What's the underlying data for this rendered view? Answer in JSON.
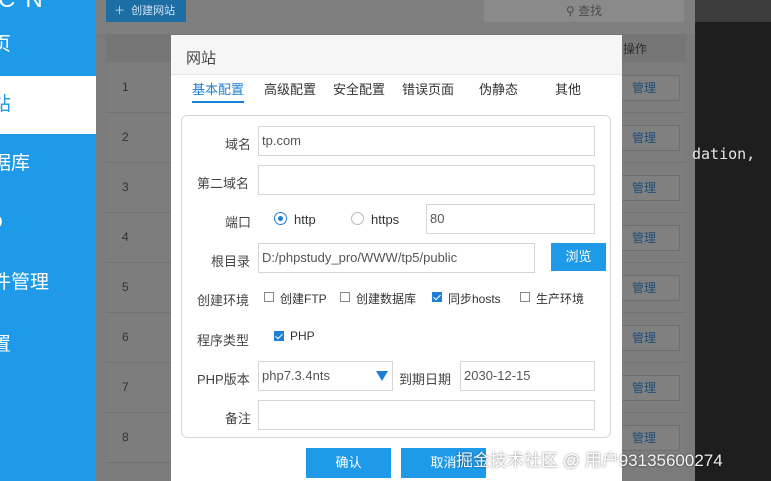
{
  "sidebar": {
    "logo": "CN",
    "items": [
      {
        "label": "页"
      },
      {
        "label": "站"
      },
      {
        "label": "据库"
      },
      {
        "label": "p"
      },
      {
        "label": "件管理"
      },
      {
        "label": "置"
      }
    ]
  },
  "toolbar": {
    "create_label": "创建网站",
    "search_label": "查找"
  },
  "table": {
    "action_header": "操作",
    "rows": [
      {
        "num": "1",
        "action": "管理"
      },
      {
        "num": "2",
        "action": "管理"
      },
      {
        "num": "3",
        "action": "管理"
      },
      {
        "num": "4",
        "action": "管理"
      },
      {
        "num": "5",
        "action": "管理"
      },
      {
        "num": "6",
        "action": "管理"
      },
      {
        "num": "7",
        "action": "管理"
      },
      {
        "num": "8",
        "action": "管理"
      }
    ]
  },
  "code": {
    "line": "dation,"
  },
  "modal": {
    "title": "网站",
    "tabs": [
      {
        "label": "基本配置"
      },
      {
        "label": "高级配置"
      },
      {
        "label": "安全配置"
      },
      {
        "label": "错误页面"
      },
      {
        "label": "伪静态"
      },
      {
        "label": "其他"
      }
    ],
    "fields": {
      "domain_label": "域名",
      "domain_value": "tp.com",
      "domain2_label": "第二域名",
      "domain2_value": "",
      "port_label": "端口",
      "port_http": "http",
      "port_https": "https",
      "port_value": "80",
      "root_label": "根目录",
      "root_value": "D:/phpstudy_pro/WWW/tp5/public",
      "browse_label": "浏览",
      "env_label": "创建环境",
      "env_options": [
        {
          "label": "创建FTP",
          "checked": false
        },
        {
          "label": "创建数据库",
          "checked": false
        },
        {
          "label": "同步hosts",
          "checked": true
        },
        {
          "label": "生产环境",
          "checked": false
        }
      ],
      "type_label": "程序类型",
      "type_option": "PHP",
      "php_label": "PHP版本",
      "php_value": "php7.3.4nts",
      "expire_label": "到期日期",
      "expire_value": "2030-12-15",
      "note_label": "备注",
      "note_value": ""
    },
    "confirm_label": "确认",
    "cancel_label": "取消"
  },
  "watermark": "掘金技术社区 @ 用户93135600274",
  "colors": {
    "accent": "#1e9ae8",
    "tab_active": "#1e7fd6"
  }
}
